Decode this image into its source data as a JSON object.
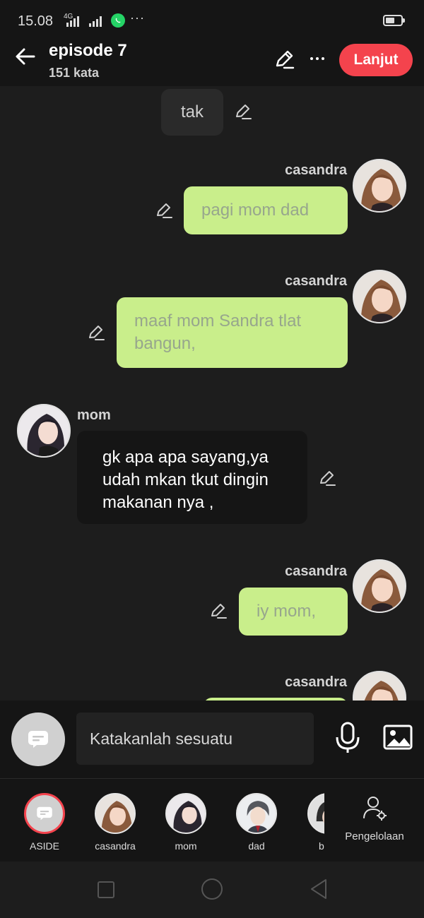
{
  "status_bar": {
    "time": "15.08",
    "network": "4G"
  },
  "header": {
    "title": "episode 7",
    "word_count": "151 kata",
    "next_label": "Lanjut"
  },
  "messages": [
    {
      "type": "narration",
      "text": "tak"
    },
    {
      "type": "right",
      "speaker": "casandra",
      "text": "pagi mom dad"
    },
    {
      "type": "right",
      "speaker": "casandra",
      "text": "maaf mom Sandra tlat bangun,"
    },
    {
      "type": "left",
      "speaker": "mom",
      "text": "gk apa apa sayang,ya udah mkan tkut dingin makanan nya ,"
    },
    {
      "type": "right",
      "speaker": "casandra",
      "text": "iy mom,"
    },
    {
      "type": "right",
      "speaker": "casandra",
      "text": ""
    }
  ],
  "composer": {
    "placeholder": "Katakanlah sesuatu"
  },
  "characters": [
    {
      "label": "ASIDE"
    },
    {
      "label": "casandra"
    },
    {
      "label": "mom"
    },
    {
      "label": "dad"
    },
    {
      "label": "b"
    }
  ],
  "manage_label": "Pengelolaan",
  "colors": {
    "accent": "#f4434d",
    "bubble_right": "#c9ee8b",
    "bubble_right_text": "#97a68d",
    "background": "#1d1d1d",
    "whatsapp": "#25d366"
  }
}
